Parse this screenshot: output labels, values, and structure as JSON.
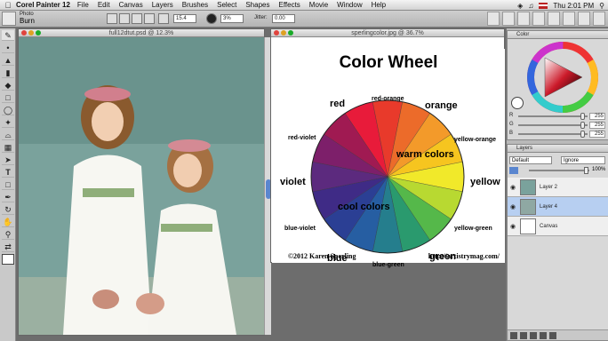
{
  "menubar": {
    "apple": "",
    "app_name": "Corel Painter 12",
    "items": [
      "File",
      "Edit",
      "Canvas",
      "Layers",
      "Brushes",
      "Select",
      "Shapes",
      "Effects",
      "Movie",
      "Window",
      "Help"
    ],
    "clock": "Thu 2:01 PM"
  },
  "property_bar": {
    "category": "Photo",
    "variant": "Burn",
    "size_value": "15.4",
    "opacity_value": "3%",
    "jitter_label": "Jitter:",
    "jitter_value": "0.00"
  },
  "toolbox": {
    "icons": [
      "brush-tool-icon",
      "dropper-icon",
      "paint-bucket-icon",
      "eraser-icon",
      "dodge-icon",
      "rect-select-icon",
      "lasso-icon",
      "magic-wand-icon",
      "crop-icon",
      "transform-icon",
      "layer-adjuster-icon",
      "text-tool-icon",
      "shape-tool-icon",
      "pen-tool-icon",
      "rotate-icon",
      "grabber-icon",
      "magnifier-icon",
      "mirror-icon",
      "color-swatch-icon"
    ],
    "text_tool_glyph": "T"
  },
  "document_left": {
    "title": "full12dtut.psd @ 12.3%"
  },
  "document_right": {
    "title": "sperlingcolor.jpg @ 36.7%"
  },
  "color_wheel_image": {
    "title": "Color Wheel",
    "labels": {
      "red": "red",
      "red_orange": "red-orange",
      "orange": "orange",
      "red_violet": "red-violet",
      "yellow_orange": "yellow-orange",
      "warm": "warm colors",
      "violet": "violet",
      "yellow": "yellow",
      "cool": "cool colors",
      "blue_violet": "blue-violet",
      "yellow_green": "yellow-green",
      "blue": "blue",
      "green": "green",
      "blue_green": "blue-green"
    },
    "copyright": "©2012 Karen Sperling",
    "url": "http://artistrymag.com/"
  },
  "color_panel": {
    "title": "Color",
    "rows": [
      {
        "label": "R",
        "value": "255"
      },
      {
        "label": "G",
        "value": "255"
      },
      {
        "label": "B",
        "value": "255"
      }
    ]
  },
  "layers_panel": {
    "title": "Layers",
    "blend_mode": "Default",
    "composite": "Ignore",
    "opacity": "100%",
    "layers": [
      {
        "name": "Layer 2",
        "selected": false
      },
      {
        "name": "Layer 4",
        "selected": true
      },
      {
        "name": "Canvas",
        "selected": false
      }
    ]
  },
  "colors": {
    "wheel": [
      "#e81b3a",
      "#e83a2b",
      "#ec6b2a",
      "#f39a2a",
      "#f6c51f",
      "#f1e92a",
      "#b8d931",
      "#55b84a",
      "#2a9a6e",
      "#257e8d",
      "#265ea2",
      "#2b3f94",
      "#3f2b86",
      "#5c2a7e",
      "#7d1f6a",
      "#a01a52"
    ],
    "accent": "#5a86cf"
  }
}
